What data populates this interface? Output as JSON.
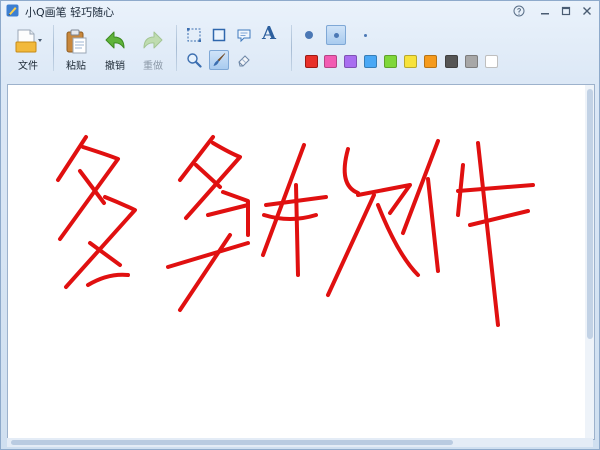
{
  "window": {
    "title": "小Q画笔 轻巧随心",
    "controls": [
      "help-icon",
      "minimize-icon",
      "maximize-icon",
      "close-icon"
    ]
  },
  "toolbar": {
    "file_label": "文件",
    "paste_label": "粘贴",
    "undo_label": "撤销",
    "redo_label": "重做",
    "tools": [
      "rect-select-icon",
      "rectangle-icon",
      "speech-bubble-icon",
      "text-icon",
      "zoom-icon",
      "brush-icon",
      "eraser-icon"
    ],
    "selected_tool": "brush-icon",
    "text_tool_glyph": "A",
    "brush_sizes": [
      "large",
      "medium",
      "small"
    ],
    "selected_brush_size": "medium"
  },
  "palette": {
    "colors": [
      "#e8302a",
      "#f25bb2",
      "#a86ef0",
      "#49a8f5",
      "#7fd73a",
      "#f7e23b",
      "#f59a1c",
      "#555555",
      "#a7a7a7",
      "#ffffff"
    ],
    "selected_color": "#e8302a"
  },
  "canvas": {
    "ink_color": "#e01010",
    "background": "#ffffff"
  }
}
